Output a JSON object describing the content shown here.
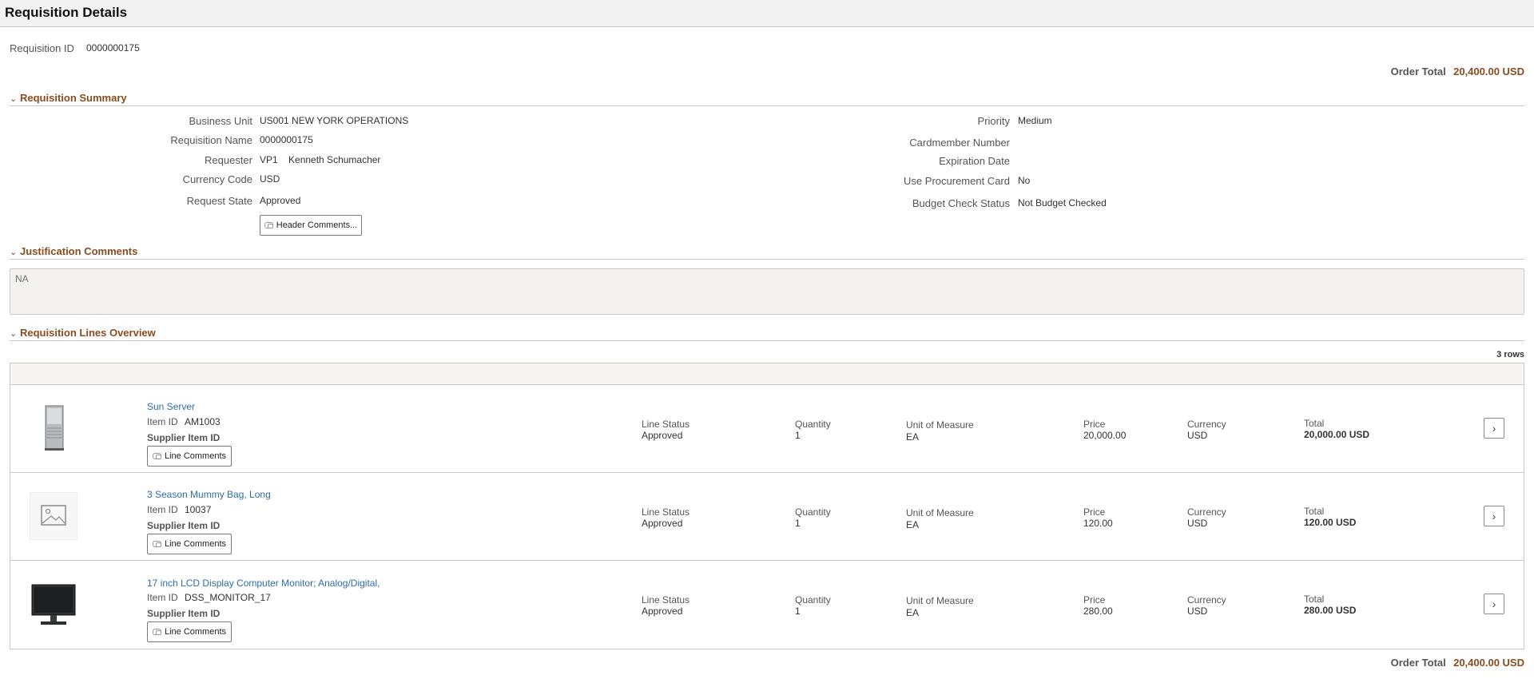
{
  "page": {
    "title": "Requisition Details"
  },
  "header": {
    "req_id_label": "Requisition ID",
    "req_id_value": "0000000175",
    "order_total_label": "Order Total",
    "order_total_value": "20,400.00 USD"
  },
  "summary": {
    "title": "Requisition Summary",
    "left": [
      {
        "label": "Business Unit",
        "value": "US001 NEW YORK OPERATIONS"
      },
      {
        "label": "Requisition Name",
        "value": "0000000175"
      },
      {
        "label": "Requester",
        "value": "VP1    Kenneth Schumacher"
      },
      {
        "label": "Currency Code",
        "value": "USD"
      },
      {
        "label": "Request State",
        "value": "Approved"
      }
    ],
    "right": [
      {
        "label": "Priority",
        "value": "Medium"
      },
      {
        "label": "Cardmember Number",
        "value": ""
      },
      {
        "label": "Expiration Date",
        "value": ""
      },
      {
        "label": "Use Procurement Card",
        "value": "No"
      },
      {
        "label": "Budget Check Status",
        "value": "Not Budget Checked"
      }
    ],
    "header_comments_label": "Header Comments..."
  },
  "justification": {
    "title": "Justification Comments",
    "text": "NA"
  },
  "lines": {
    "title": "Requisition Lines Overview",
    "row_count": "3 rows",
    "labels": {
      "item_id": "Item ID",
      "supplier_item_id": "Supplier Item ID",
      "line_comments": "Line Comments",
      "line_status": "Line Status",
      "quantity": "Quantity",
      "uom": "Unit of Measure",
      "price": "Price",
      "currency": "Currency",
      "total": "Total"
    },
    "rows": [
      {
        "name": "Sun Server",
        "item_id": "AM1003",
        "status": "Approved",
        "quantity": "1",
        "uom": "EA",
        "price": "20,000.00",
        "currency": "USD",
        "total": "20,000.00 USD",
        "thumb": "server-image"
      },
      {
        "name": "3 Season Mummy Bag, Long",
        "item_id": "10037",
        "status": "Approved",
        "quantity": "1",
        "uom": "EA",
        "price": "120.00",
        "currency": "USD",
        "total": "120.00 USD",
        "thumb": "image-placeholder-icon"
      },
      {
        "name": "17 inch LCD Display Computer Monitor; Analog/Digital,",
        "item_id": "DSS_MONITOR_17",
        "status": "Approved",
        "quantity": "1",
        "uom": "EA",
        "price": "280.00",
        "currency": "USD",
        "total": "280.00 USD",
        "thumb": "monitor-image"
      }
    ]
  },
  "footer": {
    "order_total_label": "Order Total",
    "order_total_value": "20,400.00 USD"
  },
  "colors": {
    "accent": "#8a4b1f",
    "link": "#2e6dac",
    "border": "#c9c9c9"
  }
}
